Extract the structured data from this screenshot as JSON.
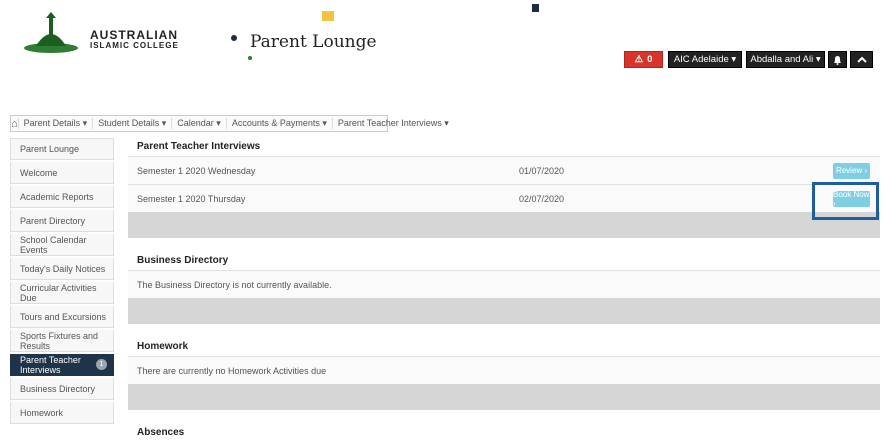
{
  "header": {
    "brand_line1": "AUSTRALIAN",
    "brand_line2": "ISLAMIC COLLEGE",
    "app_title": "Parent Lounge",
    "alert_count": "0",
    "campus_label": "AIC Adelaide ▾",
    "user_label": "Abdalla and Ali ▾"
  },
  "nav": {
    "items": [
      "Parent Details ▾",
      "Student Details ▾",
      "Calendar ▾",
      "Accounts & Payments ▾",
      "Parent Teacher Interviews ▾"
    ]
  },
  "sidebar": {
    "items": [
      {
        "label": "Parent Lounge"
      },
      {
        "label": "Welcome"
      },
      {
        "label": "Academic Reports"
      },
      {
        "label": "Parent Directory"
      },
      {
        "label": "School Calendar Events"
      },
      {
        "label": "Today's Daily Notices"
      },
      {
        "label": "Curricular Activities Due"
      },
      {
        "label": "Tours and Excursions"
      },
      {
        "label": "Sports Fixtures and Results"
      },
      {
        "label": "Parent Teacher Interviews",
        "badge": "1"
      },
      {
        "label": "Business Directory"
      },
      {
        "label": "Homework"
      }
    ]
  },
  "main": {
    "pti": {
      "title": "Parent Teacher Interviews",
      "rows": [
        {
          "name": "Semester 1 2020 Wednesday",
          "date": "01/07/2020",
          "action": "Review ›"
        },
        {
          "name": "Semester 1 2020 Thursday",
          "date": "02/07/2020",
          "action": "Book Now ›"
        }
      ]
    },
    "business": {
      "title": "Business Directory",
      "message": "The Business Directory is not currently available."
    },
    "homework": {
      "title": "Homework",
      "message": "There are currently no Homework Activities due"
    },
    "absences": {
      "title": "Absences"
    }
  },
  "colors": {
    "accent": "#1f3349",
    "alert": "#d9342b",
    "button": "#7fcfe4",
    "highlight": "#1f5e9e"
  }
}
